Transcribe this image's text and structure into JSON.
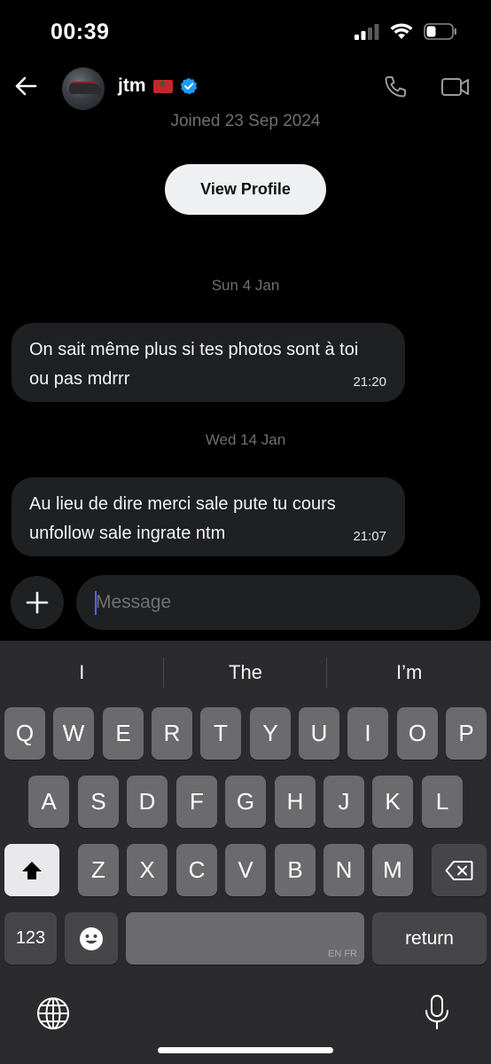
{
  "status": {
    "time": "00:39"
  },
  "header": {
    "name": "jtm",
    "joined": "Joined 23 Sep 2024",
    "view_profile_label": "View Profile"
  },
  "conversation": {
    "groups": [
      {
        "date": "Sun 4 Jan",
        "text": "On sait même plus si tes photos sont à toi ou pas mdrrr",
        "time": "21:20"
      },
      {
        "date": "Wed 14 Jan",
        "text": "Au lieu de dire merci sale pute tu cours unfollow sale ingrate ntm",
        "time": "21:07"
      }
    ]
  },
  "composer": {
    "placeholder": "Message"
  },
  "keyboard": {
    "suggestions": [
      "I",
      "The",
      "I’m"
    ],
    "row1": [
      "Q",
      "W",
      "E",
      "R",
      "T",
      "Y",
      "U",
      "I",
      "O",
      "P"
    ],
    "row2": [
      "A",
      "S",
      "D",
      "F",
      "G",
      "H",
      "J",
      "K",
      "L"
    ],
    "row3": [
      "Z",
      "X",
      "C",
      "V",
      "B",
      "N",
      "M"
    ],
    "numbers_label": "123",
    "space_lang_label": "EN FR",
    "return_label": "return"
  },
  "colors": {
    "accent": "#1d9bf0",
    "bubble": "#1f2022",
    "keyboard": "#2b2b2d",
    "key": "#6b6b6d"
  }
}
